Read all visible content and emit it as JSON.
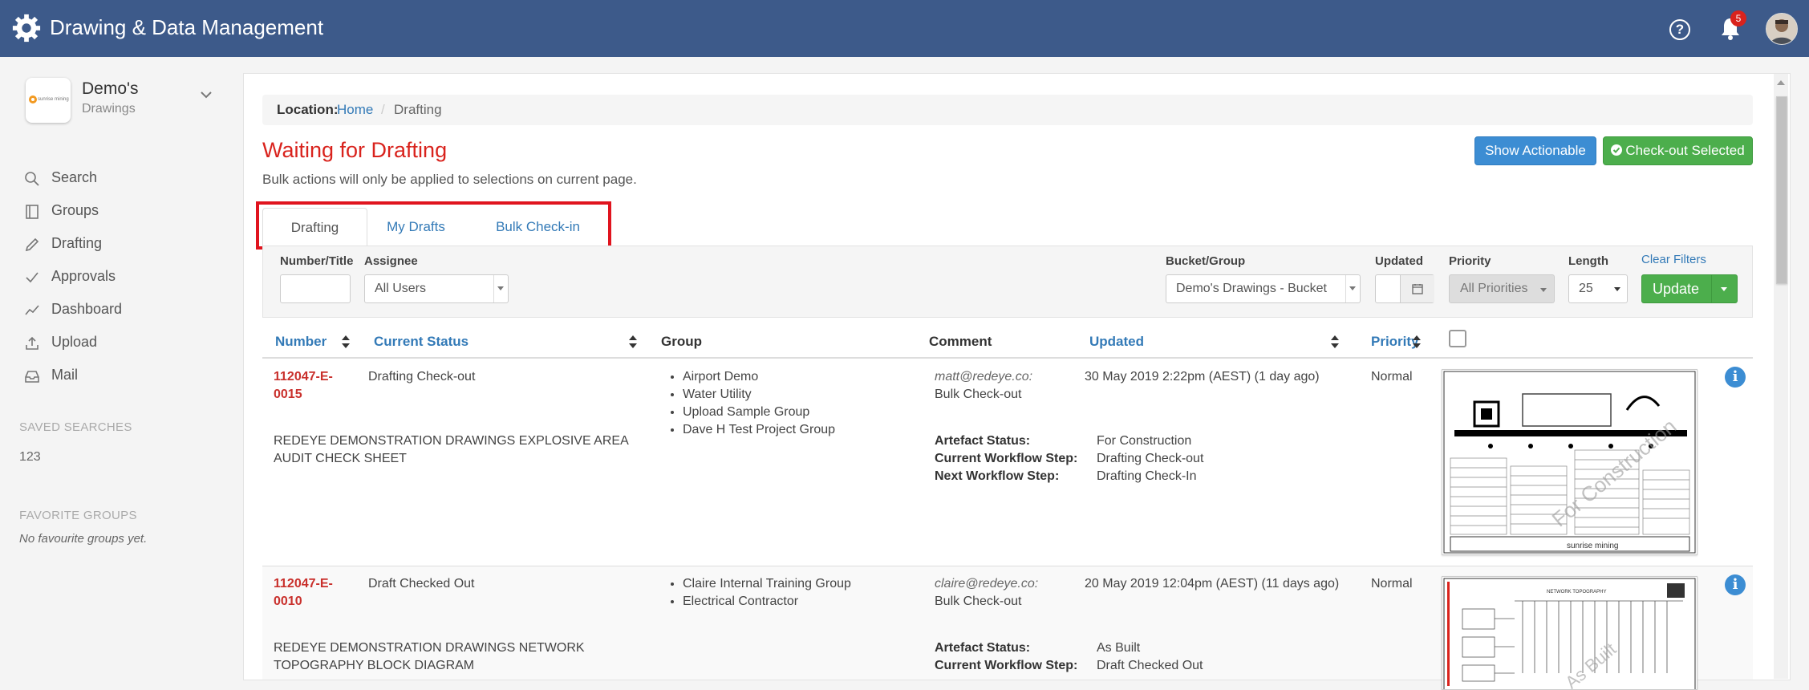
{
  "app": {
    "title": "Drawing & Data Management",
    "notifications": "5",
    "help_glyph": "?"
  },
  "tenant": {
    "name": "Demo's",
    "subtitle": "Drawings",
    "logo_text": "sunrise mining"
  },
  "nav": [
    {
      "label": "Search",
      "icon": "search-icon"
    },
    {
      "label": "Groups",
      "icon": "book-icon"
    },
    {
      "label": "Drafting",
      "icon": "pencil-icon"
    },
    {
      "label": "Approvals",
      "icon": "check-icon"
    },
    {
      "label": "Dashboard",
      "icon": "line-chart-icon"
    },
    {
      "label": "Upload",
      "icon": "upload-icon"
    },
    {
      "label": "Mail",
      "icon": "inbox-icon"
    }
  ],
  "saved_searches": {
    "heading": "SAVED SEARCHES",
    "items": [
      "123"
    ]
  },
  "favorite_groups": {
    "heading": "FAVORITE GROUPS",
    "empty": "No favourite groups yet."
  },
  "breadcrumb": {
    "label": "Location:",
    "home": "Home",
    "separator": "/",
    "current": "Drafting"
  },
  "page": {
    "title": "Waiting for Drafting",
    "note": "Bulk actions will only be applied to selections on current page.",
    "show_actionable": "Show Actionable",
    "checkout_selected": "Check-out Selected"
  },
  "tabs": [
    "Drafting",
    "My Drafts",
    "Bulk Check-in"
  ],
  "filters": {
    "number_title": {
      "label": "Number/Title",
      "value": ""
    },
    "assignee": {
      "label": "Assignee",
      "value": "All Users"
    },
    "bucket": {
      "label": "Bucket/Group",
      "value": "Demo's Drawings - Bucket"
    },
    "updated": {
      "label": "Updated",
      "value": ""
    },
    "priority": {
      "label": "Priority",
      "value": "All Priorities"
    },
    "length": {
      "label": "Length",
      "value": "25"
    },
    "clear": "Clear Filters",
    "update": "Update"
  },
  "columns": {
    "number": "Number",
    "status": "Current Status",
    "group": "Group",
    "comment": "Comment",
    "updated": "Updated",
    "priority": "Priority"
  },
  "labels": {
    "artefact_status": "Artefact Status:",
    "current_step": "Current Workflow Step:",
    "next_step": "Next Workflow Step:"
  },
  "rows": [
    {
      "number_line1": "112047-E-",
      "number_line2": "0015",
      "status": "Drafting Check-out",
      "title": "REDEYE DEMONSTRATION DRAWINGS EXPLOSIVE AREA AUDIT CHECK SHEET",
      "groups": [
        "Airport Demo",
        "Water Utility",
        "Upload Sample Group",
        "Dave H Test Project Group"
      ],
      "comment_user": "matt@redeye.co:",
      "comment_text": "Bulk Check-out",
      "updated": "30 May 2019 2:22pm (AEST) (1 day ago)",
      "priority": "Normal",
      "artefact_status": "For Construction",
      "current_step": "Drafting Check-out",
      "next_step": "Drafting Check-In",
      "stamp": "For Construction"
    },
    {
      "number_line1": "112047-E-",
      "number_line2": "0010",
      "status": "Draft Checked Out",
      "title": "REDEYE DEMONSTRATION DRAWINGS NETWORK TOPOGRAPHY BLOCK DIAGRAM",
      "groups": [
        "Claire Internal Training Group",
        "Electrical Contractor"
      ],
      "comment_user": "claire@redeye.co:",
      "comment_text": "Bulk Check-out",
      "updated": "20 May 2019 12:04pm (AEST) (11 days ago)",
      "priority": "Normal",
      "artefact_status": "As Built",
      "current_step": "Draft Checked Out",
      "stamp": "As Built"
    }
  ],
  "colors": {
    "topbar": "#3d5a8a",
    "title_red": "#d9231d",
    "link_blue": "#337ab7",
    "green": "#4cae4c",
    "highlight": "#e0141e"
  }
}
